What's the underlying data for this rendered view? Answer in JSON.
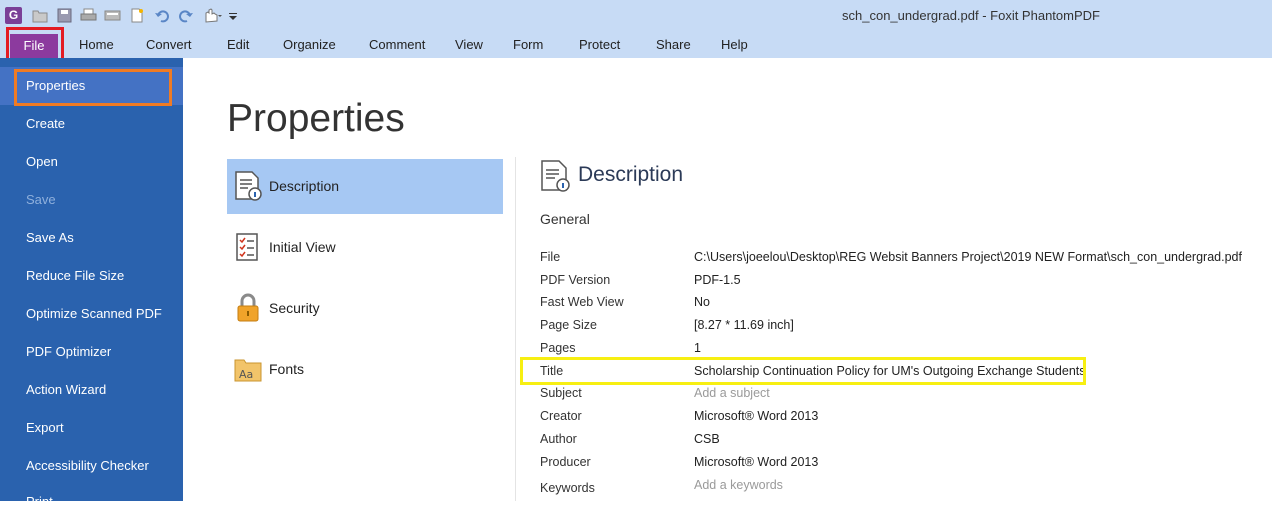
{
  "window": {
    "title": "sch_con_undergrad.pdf - Foxit PhantomPDF"
  },
  "quick_access": {
    "logo_letter": "G",
    "icons": [
      "foxit-logo-icon",
      "open-folder-icon",
      "save-icon",
      "print-icon",
      "scan-icon",
      "new-icon",
      "undo-icon",
      "redo-icon",
      "hand-tool-icon",
      "customize-dropdown-icon"
    ]
  },
  "ribbon": {
    "tabs": [
      {
        "label": "File",
        "active": true
      },
      {
        "label": "Home"
      },
      {
        "label": "Convert"
      },
      {
        "label": "Edit"
      },
      {
        "label": "Organize"
      },
      {
        "label": "Comment"
      },
      {
        "label": "View"
      },
      {
        "label": "Form"
      },
      {
        "label": "Protect"
      },
      {
        "label": "Share"
      },
      {
        "label": "Help"
      }
    ]
  },
  "sidebar": {
    "items": [
      {
        "label": "Properties",
        "active": true
      },
      {
        "label": "Create"
      },
      {
        "label": "Open"
      },
      {
        "label": "Save",
        "disabled": true
      },
      {
        "label": "Save As"
      },
      {
        "label": "Reduce File Size"
      },
      {
        "label": "Optimize Scanned PDF"
      },
      {
        "label": "PDF Optimizer"
      },
      {
        "label": "Action Wizard"
      },
      {
        "label": "Export"
      },
      {
        "label": "Accessibility Checker"
      },
      {
        "label": "Print"
      }
    ]
  },
  "main": {
    "heading": "Properties",
    "categories": [
      {
        "label": "Description",
        "icon": "description-icon",
        "active": true
      },
      {
        "label": "Initial View",
        "icon": "initial-view-icon"
      },
      {
        "label": "Security",
        "icon": "security-lock-icon"
      },
      {
        "label": "Fonts",
        "icon": "fonts-folder-icon"
      }
    ],
    "description": {
      "heading": "Description",
      "section": "General",
      "fields": [
        {
          "key": "File",
          "value": "C:\\Users\\joeelou\\Desktop\\REG Websit Banners Project\\2019 NEW Format\\sch_con_undergrad.pdf"
        },
        {
          "key": "PDF Version",
          "value": "PDF-1.5"
        },
        {
          "key": "Fast Web View",
          "value": "No"
        },
        {
          "key": "Page Size",
          "value": "[8.27 * 11.69 inch]"
        },
        {
          "key": "Pages",
          "value": "1"
        },
        {
          "key": "Title",
          "value": "Scholarship Continuation Policy for UM's Outgoing Exchange Students"
        },
        {
          "key": "Subject",
          "placeholder": "Add a subject"
        },
        {
          "key": "Creator",
          "value": "Microsoft® Word 2013"
        },
        {
          "key": "Author",
          "value": "CSB"
        },
        {
          "key": "Producer",
          "value": "Microsoft® Word 2013"
        },
        {
          "key": "Keywords",
          "placeholder": "Add a keywords"
        }
      ]
    }
  },
  "highlight_colors": {
    "file_tab": "#e31b23",
    "properties_item": "#f07b24",
    "title_field": "#f7ef12"
  }
}
